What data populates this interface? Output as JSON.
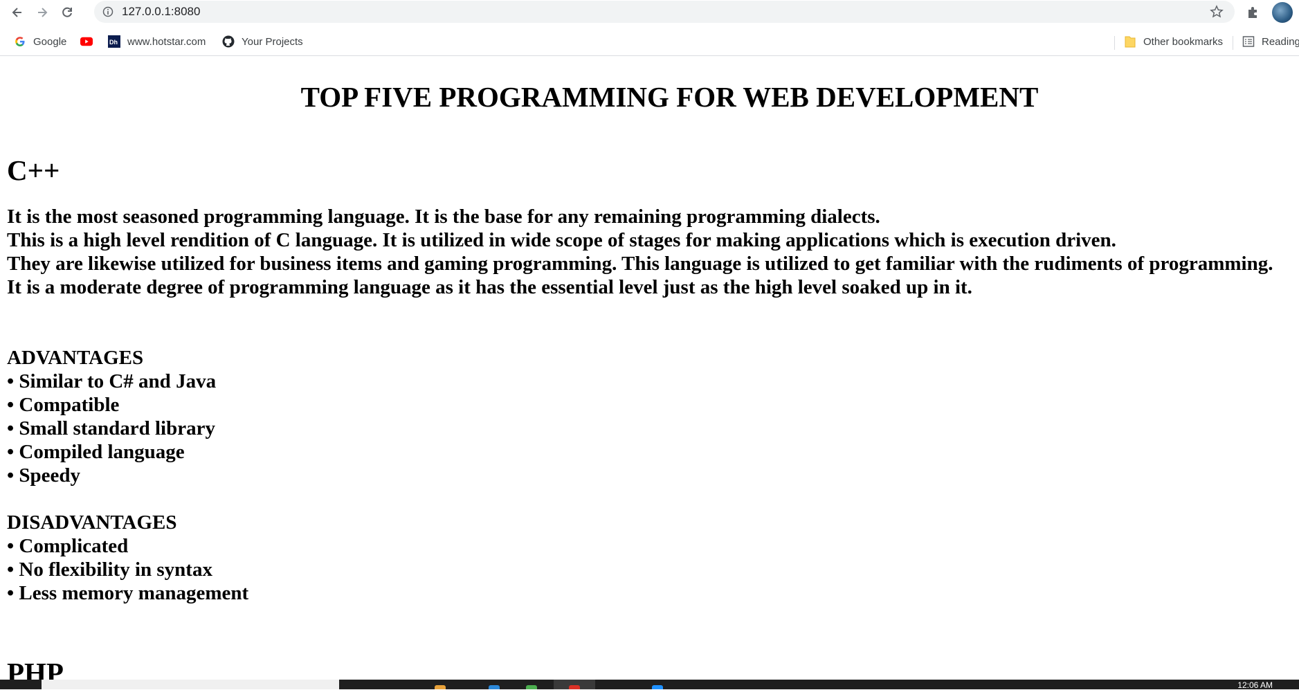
{
  "browser": {
    "url": "127.0.0.1:8080",
    "bookmarks": [
      {
        "label": "Google",
        "icon": "google-icon"
      },
      {
        "label": "",
        "icon": "youtube-icon"
      },
      {
        "label": "www.hotstar.com",
        "icon": "hotstar-icon"
      },
      {
        "label": "Your Projects",
        "icon": "github-icon"
      }
    ],
    "other_bookmarks": "Other bookmarks",
    "reading_list": "Reading"
  },
  "page": {
    "title": "TOP FIVE PROGRAMMING FOR WEB DEVELOPMENT",
    "sections": [
      {
        "heading": "C++",
        "description": [
          "It is the most seasoned programming language. It is the base for any remaining programming dialects.",
          "This is a high level rendition of C language. It is utilized in wide scope of stages for making applications which is execution driven.",
          "They are likewise utilized for business items and gaming programming. This language is utilized to get familiar with the rudiments of programming.",
          "It is a moderate degree of programming language as it has the essential level just as the high level soaked up in it."
        ],
        "advantages_title": "ADVANTAGES",
        "advantages": [
          "• Similar to C# and Java",
          "• Compatible",
          "• Small standard library",
          "• Compiled language",
          "• Speedy"
        ],
        "disadvantages_title": "DISADVANTAGES",
        "disadvantages": [
          "• Complicated",
          "• No flexibility in syntax",
          "• Less memory management"
        ]
      },
      {
        "heading": "PHP"
      }
    ]
  },
  "taskbar": {
    "clock": "12:06 AM"
  }
}
